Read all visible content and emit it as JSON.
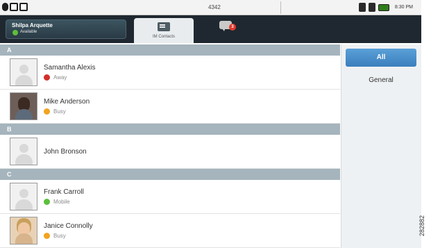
{
  "status_bar": {
    "center_text": "4342",
    "time": "8:30 PM"
  },
  "presence": {
    "user_name": "Shilpa Arquette",
    "status": "Available",
    "status_color": "#5fbf3a"
  },
  "tabs": {
    "im_contacts_label": "IM Contacts",
    "messages_badge": "3"
  },
  "sections": [
    {
      "letter": "A",
      "contacts": [
        {
          "name": "Samantha Alexis",
          "status": "Away",
          "status_type": "away",
          "avatar": "placeholder"
        },
        {
          "name": "Mike Anderson",
          "status": "Busy",
          "status_type": "busy",
          "avatar": "photo"
        }
      ]
    },
    {
      "letter": "B",
      "contacts": [
        {
          "name": "John Bronson",
          "status": "",
          "status_type": "",
          "avatar": "placeholder"
        }
      ]
    },
    {
      "letter": "C",
      "contacts": [
        {
          "name": "Frank Carroll",
          "status": "Mobile",
          "status_type": "mobile",
          "avatar": "placeholder"
        },
        {
          "name": "Janice Connolly",
          "status": "Busy",
          "status_type": "busy",
          "avatar": "photo"
        }
      ]
    }
  ],
  "filter": {
    "all_label": "All",
    "general_label": "General"
  },
  "figure_number": "282882",
  "colors": {
    "header_bg": "#1f2830",
    "section_bg": "#a5b4bd",
    "filter_selected": "#4a8fcb",
    "away": "#d3302a",
    "busy": "#f2a320",
    "mobile": "#5cbf3a"
  }
}
